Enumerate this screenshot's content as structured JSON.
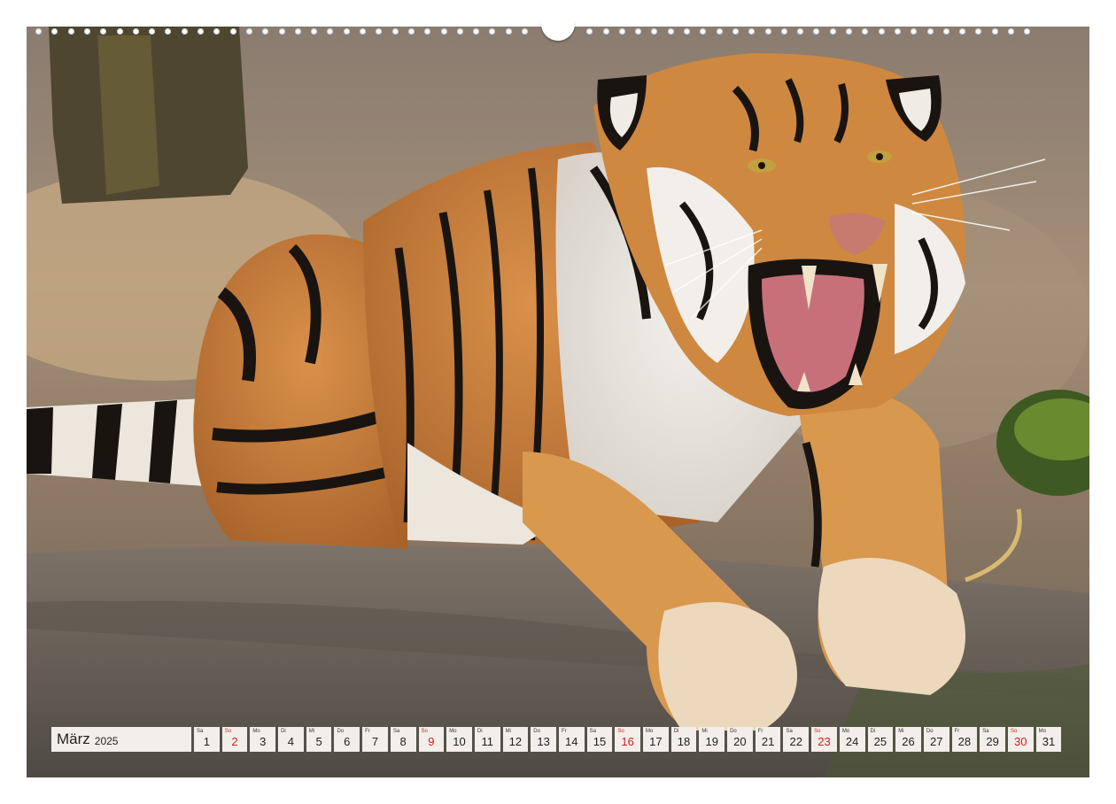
{
  "calendar": {
    "month": "März",
    "year": "2025",
    "days": [
      {
        "wd": "Sa",
        "num": "1",
        "sunday": false
      },
      {
        "wd": "So",
        "num": "2",
        "sunday": true
      },
      {
        "wd": "Mo",
        "num": "3",
        "sunday": false
      },
      {
        "wd": "Di",
        "num": "4",
        "sunday": false
      },
      {
        "wd": "Mi",
        "num": "5",
        "sunday": false
      },
      {
        "wd": "Do",
        "num": "6",
        "sunday": false
      },
      {
        "wd": "Fr",
        "num": "7",
        "sunday": false
      },
      {
        "wd": "Sa",
        "num": "8",
        "sunday": false
      },
      {
        "wd": "So",
        "num": "9",
        "sunday": true
      },
      {
        "wd": "Mo",
        "num": "10",
        "sunday": false
      },
      {
        "wd": "Di",
        "num": "11",
        "sunday": false
      },
      {
        "wd": "Mi",
        "num": "12",
        "sunday": false
      },
      {
        "wd": "Do",
        "num": "13",
        "sunday": false
      },
      {
        "wd": "Fr",
        "num": "14",
        "sunday": false
      },
      {
        "wd": "Sa",
        "num": "15",
        "sunday": false
      },
      {
        "wd": "So",
        "num": "16",
        "sunday": true
      },
      {
        "wd": "Mo",
        "num": "17",
        "sunday": false
      },
      {
        "wd": "Di",
        "num": "18",
        "sunday": false
      },
      {
        "wd": "Mi",
        "num": "19",
        "sunday": false
      },
      {
        "wd": "Do",
        "num": "20",
        "sunday": false
      },
      {
        "wd": "Fr",
        "num": "21",
        "sunday": false
      },
      {
        "wd": "Sa",
        "num": "22",
        "sunday": false
      },
      {
        "wd": "So",
        "num": "23",
        "sunday": true
      },
      {
        "wd": "Mo",
        "num": "24",
        "sunday": false
      },
      {
        "wd": "Di",
        "num": "25",
        "sunday": false
      },
      {
        "wd": "Mi",
        "num": "26",
        "sunday": false
      },
      {
        "wd": "Do",
        "num": "27",
        "sunday": false
      },
      {
        "wd": "Fr",
        "num": "28",
        "sunday": false
      },
      {
        "wd": "Sa",
        "num": "29",
        "sunday": false
      },
      {
        "wd": "So",
        "num": "30",
        "sunday": true
      },
      {
        "wd": "Mo",
        "num": "31",
        "sunday": false
      }
    ]
  },
  "colors": {
    "sunday": "#d42020",
    "cell_background": "#f3eee9",
    "tiger_orange": "#c8803c",
    "stripe": "#1a1410"
  },
  "photo": {
    "subject_icon": "tiger-photo"
  }
}
